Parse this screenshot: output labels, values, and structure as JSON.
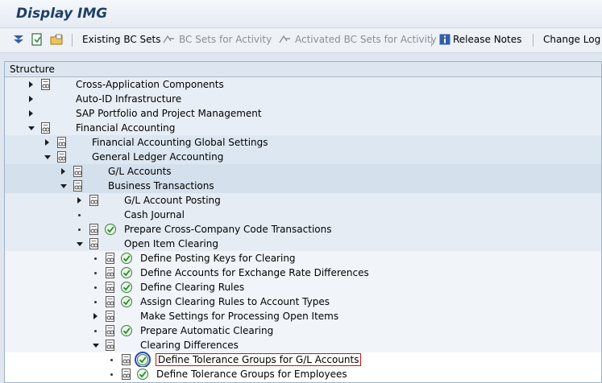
{
  "window": {
    "title": "Display IMG"
  },
  "toolbar": {
    "existing_bc_sets": "Existing BC Sets",
    "bc_sets_for_activity": "BC Sets for Activity",
    "activated_bc_sets": "Activated BC Sets for Activity",
    "release_notes": "Release Notes",
    "change_log": "Change Log"
  },
  "tree": {
    "header": "Structure",
    "rows": [
      {
        "label": "Cross-Application Components"
      },
      {
        "label": "Auto-ID Infrastructure"
      },
      {
        "label": "SAP Portfolio and Project Management"
      },
      {
        "label": "Financial Accounting"
      },
      {
        "label": "Financial Accounting Global Settings"
      },
      {
        "label": "General Ledger Accounting"
      },
      {
        "label": "G/L Accounts"
      },
      {
        "label": "Business Transactions"
      },
      {
        "label": "G/L Account Posting"
      },
      {
        "label": "Cash Journal"
      },
      {
        "label": "Prepare Cross-Company Code Transactions"
      },
      {
        "label": "Open Item Clearing"
      },
      {
        "label": "Define Posting Keys for Clearing"
      },
      {
        "label": "Define Accounts for Exchange Rate Differences"
      },
      {
        "label": "Define Clearing Rules"
      },
      {
        "label": "Assign Clearing Rules to Account Types"
      },
      {
        "label": "Make Settings for Processing Open Items"
      },
      {
        "label": "Prepare Automatic Clearing"
      },
      {
        "label": "Clearing Differences"
      },
      {
        "label": "Define Tolerance Groups for G/L Accounts"
      },
      {
        "label": "Define Tolerance Groups for Employees"
      }
    ]
  },
  "colors": {
    "selection_box": "#d01010",
    "highlight_circle": "#2a43c6",
    "title": "#1f3f66"
  }
}
